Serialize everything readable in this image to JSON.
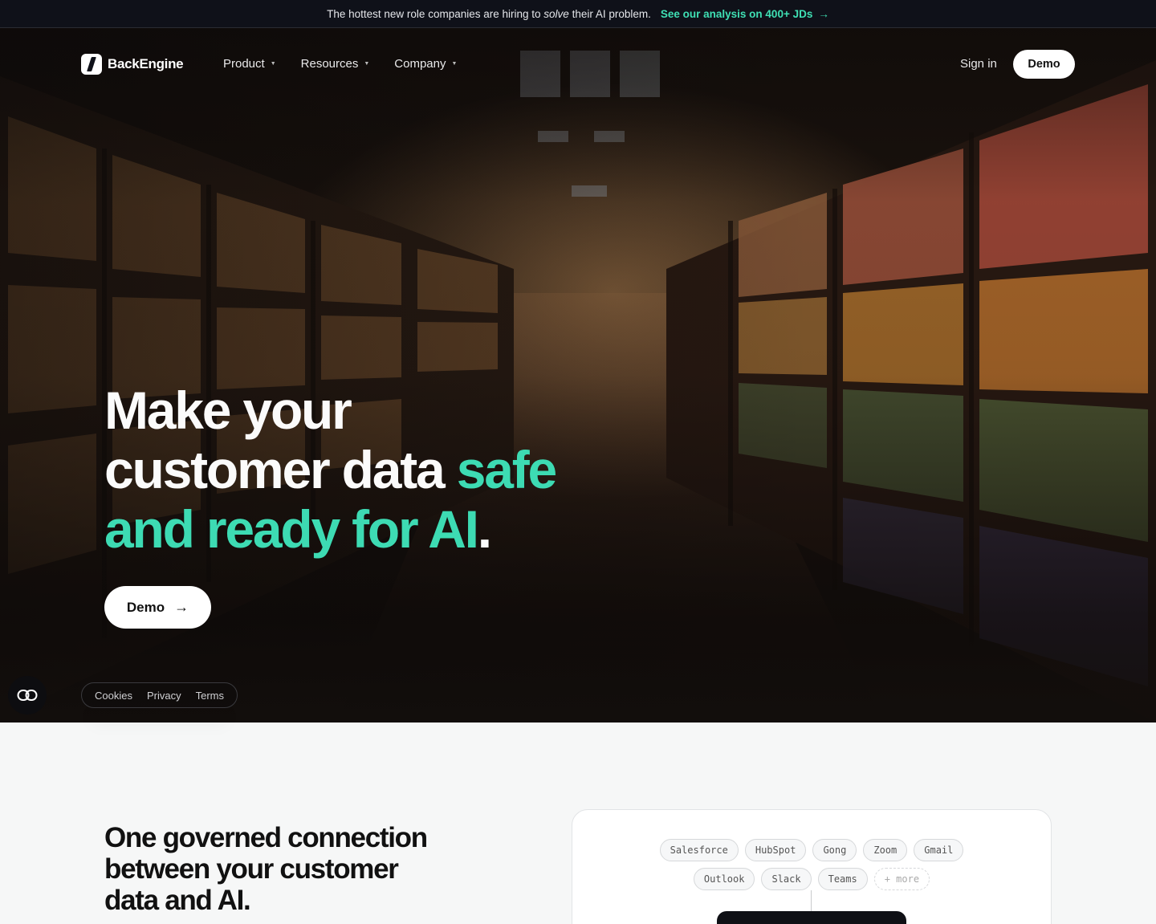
{
  "announcement": {
    "text_before": "The hottest new role companies are hiring to",
    "text_emph": "solve",
    "text_after": "their AI problem.",
    "link_label": "See our analysis on 400+ JDs",
    "link_arrow": "→",
    "accent_color": "#3fe0b4"
  },
  "nav": {
    "brand": "BackEngine",
    "logo_icon": "slash-logo-icon",
    "menu": [
      {
        "label": "Product",
        "icon": "caret-down-icon"
      },
      {
        "label": "Resources",
        "icon": "caret-down-icon"
      },
      {
        "label": "Company",
        "icon": "caret-down-icon"
      }
    ],
    "caret": "▼",
    "sign_in": "Sign in",
    "demo": "Demo"
  },
  "hero": {
    "line1": "Make your",
    "line2_plain": "customer data",
    "line2_accent": "safe",
    "line3_accent": "and ready for AI",
    "line3_end": ".",
    "accent_color": "#3ddbb3",
    "cta_label": "Demo",
    "cta_arrow": "→",
    "background_image": "archive-shelves-photo"
  },
  "footer_links": {
    "cookies": "Cookies",
    "privacy": "Privacy",
    "terms": "Terms",
    "cookie_icon": "cookie-settings-icon"
  },
  "section": {
    "title": "One governed connection between your customer data and AI."
  },
  "integrations": {
    "chips": [
      "Salesforce",
      "HubSpot",
      "Gong",
      "Zoom",
      "Gmail",
      "Outlook",
      "Slack",
      "Teams"
    ],
    "more": "+ more"
  }
}
